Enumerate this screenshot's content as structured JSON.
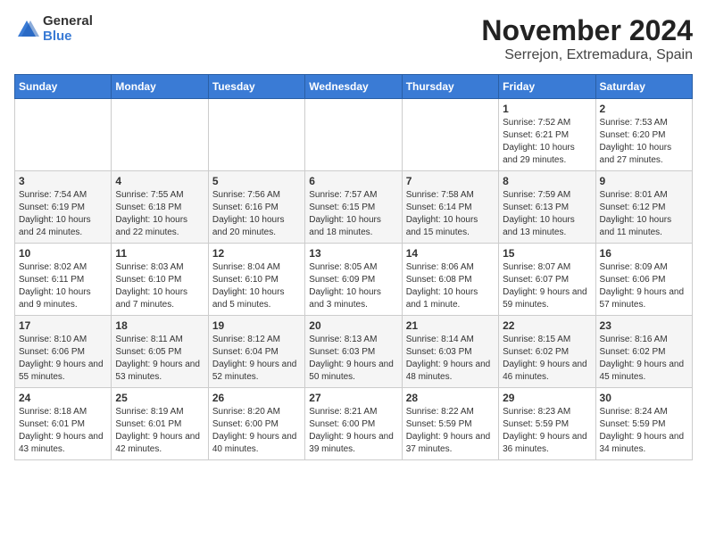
{
  "logo": {
    "general": "General",
    "blue": "Blue"
  },
  "title": "November 2024",
  "subtitle": "Serrejon, Extremadura, Spain",
  "days_of_week": [
    "Sunday",
    "Monday",
    "Tuesday",
    "Wednesday",
    "Thursday",
    "Friday",
    "Saturday"
  ],
  "weeks": [
    [
      {
        "day": "",
        "info": ""
      },
      {
        "day": "",
        "info": ""
      },
      {
        "day": "",
        "info": ""
      },
      {
        "day": "",
        "info": ""
      },
      {
        "day": "",
        "info": ""
      },
      {
        "day": "1",
        "info": "Sunrise: 7:52 AM\nSunset: 6:21 PM\nDaylight: 10 hours and 29 minutes."
      },
      {
        "day": "2",
        "info": "Sunrise: 7:53 AM\nSunset: 6:20 PM\nDaylight: 10 hours and 27 minutes."
      }
    ],
    [
      {
        "day": "3",
        "info": "Sunrise: 7:54 AM\nSunset: 6:19 PM\nDaylight: 10 hours and 24 minutes."
      },
      {
        "day": "4",
        "info": "Sunrise: 7:55 AM\nSunset: 6:18 PM\nDaylight: 10 hours and 22 minutes."
      },
      {
        "day": "5",
        "info": "Sunrise: 7:56 AM\nSunset: 6:16 PM\nDaylight: 10 hours and 20 minutes."
      },
      {
        "day": "6",
        "info": "Sunrise: 7:57 AM\nSunset: 6:15 PM\nDaylight: 10 hours and 18 minutes."
      },
      {
        "day": "7",
        "info": "Sunrise: 7:58 AM\nSunset: 6:14 PM\nDaylight: 10 hours and 15 minutes."
      },
      {
        "day": "8",
        "info": "Sunrise: 7:59 AM\nSunset: 6:13 PM\nDaylight: 10 hours and 13 minutes."
      },
      {
        "day": "9",
        "info": "Sunrise: 8:01 AM\nSunset: 6:12 PM\nDaylight: 10 hours and 11 minutes."
      }
    ],
    [
      {
        "day": "10",
        "info": "Sunrise: 8:02 AM\nSunset: 6:11 PM\nDaylight: 10 hours and 9 minutes."
      },
      {
        "day": "11",
        "info": "Sunrise: 8:03 AM\nSunset: 6:10 PM\nDaylight: 10 hours and 7 minutes."
      },
      {
        "day": "12",
        "info": "Sunrise: 8:04 AM\nSunset: 6:10 PM\nDaylight: 10 hours and 5 minutes."
      },
      {
        "day": "13",
        "info": "Sunrise: 8:05 AM\nSunset: 6:09 PM\nDaylight: 10 hours and 3 minutes."
      },
      {
        "day": "14",
        "info": "Sunrise: 8:06 AM\nSunset: 6:08 PM\nDaylight: 10 hours and 1 minute."
      },
      {
        "day": "15",
        "info": "Sunrise: 8:07 AM\nSunset: 6:07 PM\nDaylight: 9 hours and 59 minutes."
      },
      {
        "day": "16",
        "info": "Sunrise: 8:09 AM\nSunset: 6:06 PM\nDaylight: 9 hours and 57 minutes."
      }
    ],
    [
      {
        "day": "17",
        "info": "Sunrise: 8:10 AM\nSunset: 6:06 PM\nDaylight: 9 hours and 55 minutes."
      },
      {
        "day": "18",
        "info": "Sunrise: 8:11 AM\nSunset: 6:05 PM\nDaylight: 9 hours and 53 minutes."
      },
      {
        "day": "19",
        "info": "Sunrise: 8:12 AM\nSunset: 6:04 PM\nDaylight: 9 hours and 52 minutes."
      },
      {
        "day": "20",
        "info": "Sunrise: 8:13 AM\nSunset: 6:03 PM\nDaylight: 9 hours and 50 minutes."
      },
      {
        "day": "21",
        "info": "Sunrise: 8:14 AM\nSunset: 6:03 PM\nDaylight: 9 hours and 48 minutes."
      },
      {
        "day": "22",
        "info": "Sunrise: 8:15 AM\nSunset: 6:02 PM\nDaylight: 9 hours and 46 minutes."
      },
      {
        "day": "23",
        "info": "Sunrise: 8:16 AM\nSunset: 6:02 PM\nDaylight: 9 hours and 45 minutes."
      }
    ],
    [
      {
        "day": "24",
        "info": "Sunrise: 8:18 AM\nSunset: 6:01 PM\nDaylight: 9 hours and 43 minutes."
      },
      {
        "day": "25",
        "info": "Sunrise: 8:19 AM\nSunset: 6:01 PM\nDaylight: 9 hours and 42 minutes."
      },
      {
        "day": "26",
        "info": "Sunrise: 8:20 AM\nSunset: 6:00 PM\nDaylight: 9 hours and 40 minutes."
      },
      {
        "day": "27",
        "info": "Sunrise: 8:21 AM\nSunset: 6:00 PM\nDaylight: 9 hours and 39 minutes."
      },
      {
        "day": "28",
        "info": "Sunrise: 8:22 AM\nSunset: 5:59 PM\nDaylight: 9 hours and 37 minutes."
      },
      {
        "day": "29",
        "info": "Sunrise: 8:23 AM\nSunset: 5:59 PM\nDaylight: 9 hours and 36 minutes."
      },
      {
        "day": "30",
        "info": "Sunrise: 8:24 AM\nSunset: 5:59 PM\nDaylight: 9 hours and 34 minutes."
      }
    ]
  ]
}
